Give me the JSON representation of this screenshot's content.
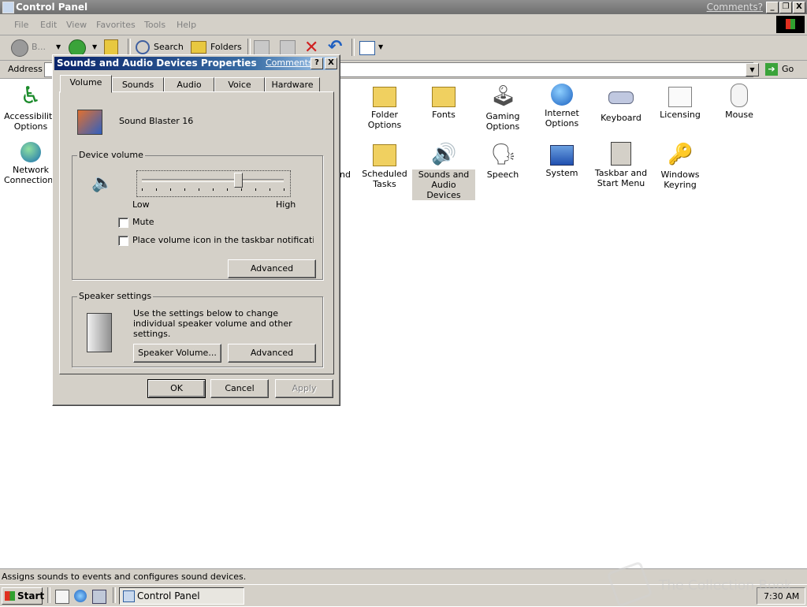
{
  "window": {
    "title": "Control Panel",
    "comments_link": "Comments?",
    "caption_buttons": [
      "_",
      "❐",
      "X"
    ]
  },
  "menubar": [
    "File",
    "Edit",
    "View",
    "Favorites",
    "Tools",
    "Help"
  ],
  "toolbar": {
    "back_label": "B...",
    "search_label": "Search",
    "folders_label": "Folders"
  },
  "addressbar": {
    "label": "Address",
    "go_label": "Go"
  },
  "control_panel_items": [
    {
      "id": "accessibility",
      "label": "Accessibility Options",
      "icon": "accessibility-icon"
    },
    {
      "id": "folder-options",
      "label": "Folder Options",
      "icon": "folder-options-icon"
    },
    {
      "id": "fonts",
      "label": "Fonts",
      "icon": "fonts-icon"
    },
    {
      "id": "gaming-options",
      "label": "Gaming Options",
      "icon": "joystick-icon"
    },
    {
      "id": "internet-options",
      "label": "Internet Options",
      "icon": "globe-icon"
    },
    {
      "id": "keyboard",
      "label": "Keyboard",
      "icon": "keyboard-icon"
    },
    {
      "id": "licensing",
      "label": "Licensing",
      "icon": "certificate-icon"
    },
    {
      "id": "mouse",
      "label": "Mouse",
      "icon": "mouse-icon"
    },
    {
      "id": "network-connections",
      "label": "Network Connections",
      "icon": "network-icon"
    },
    {
      "id": "partial-hidden",
      "label": "nd",
      "icon": ""
    },
    {
      "id": "scheduled-tasks",
      "label": "Scheduled Tasks",
      "icon": "scheduled-tasks-icon"
    },
    {
      "id": "sounds-audio",
      "label": "Sounds and Audio Devices",
      "icon": "speaker-icon",
      "selected": true
    },
    {
      "id": "speech",
      "label": "Speech",
      "icon": "speech-icon"
    },
    {
      "id": "system",
      "label": "System",
      "icon": "system-icon"
    },
    {
      "id": "taskbar-start",
      "label": "Taskbar and Start Menu",
      "icon": "taskbar-icon"
    },
    {
      "id": "windows-keyring",
      "label": "Windows Keyring",
      "icon": "keyring-icon"
    }
  ],
  "dialog": {
    "title": "Sounds and Audio Devices Properties",
    "comments_link": "Comments?",
    "help_button": "?",
    "close_button": "X",
    "tabs": [
      "Volume",
      "Sounds",
      "Audio",
      "Voice",
      "Hardware"
    ],
    "active_tab": "Volume",
    "device_name": "Sound Blaster 16",
    "device_volume": {
      "group_label": "Device volume",
      "low_label": "Low",
      "high_label": "High",
      "level_fraction": 0.68,
      "mute_label": "Mute",
      "mute_checked": false,
      "tray_icon_label": "Place volume icon in the taskbar notification area",
      "tray_icon_checked": false,
      "advanced_label": "Advanced"
    },
    "speaker_settings": {
      "group_label": "Speaker settings",
      "description": "Use the settings below to change individual speaker volume and other settings.",
      "speaker_volume_label": "Speaker Volume...",
      "advanced_label": "Advanced"
    },
    "ok_label": "OK",
    "cancel_label": "Cancel",
    "apply_label": "Apply"
  },
  "statusbar": {
    "text": "Assigns sounds to events and configures sound devices."
  },
  "taskbar": {
    "start_label": "Start",
    "task_label": "Control Panel",
    "clock": "7:30 AM"
  },
  "watermark": "The Collection Book",
  "colors": {
    "dialog_title_start": "#0a246a",
    "dialog_title_end": "#a6caf0",
    "face": "#d4d0c8"
  }
}
